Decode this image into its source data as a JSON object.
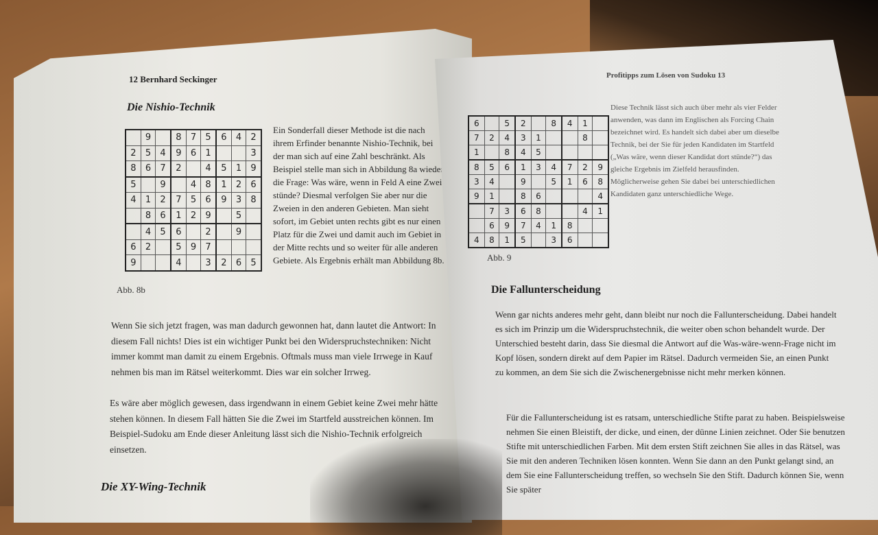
{
  "left_page": {
    "header": "12 Bernhard Seckinger",
    "section_title": "Die Nishio-Technik",
    "figure_caption": "Abb. 8b",
    "grid": [
      [
        "",
        "9",
        "",
        "8",
        "7",
        "5",
        "6",
        "4",
        "2"
      ],
      [
        "2",
        "5",
        "4",
        "9",
        "6",
        "1",
        "",
        "",
        "3"
      ],
      [
        "8",
        "6",
        "7",
        "2",
        "",
        "4",
        "5",
        "1",
        "9"
      ],
      [
        "5",
        "",
        "9",
        "",
        "4",
        "8",
        "1",
        "2",
        "6"
      ],
      [
        "4",
        "1",
        "2",
        "7",
        "5",
        "6",
        "9",
        "3",
        "8"
      ],
      [
        "",
        "8",
        "6",
        "1",
        "2",
        "9",
        "",
        "5",
        ""
      ],
      [
        "",
        "4",
        "5",
        "6",
        "",
        "2",
        "",
        "9",
        ""
      ],
      [
        "6",
        "2",
        "",
        "5",
        "9",
        "7",
        "",
        "",
        ""
      ],
      [
        "9",
        "",
        "",
        "4",
        "",
        "3",
        "2",
        "6",
        "5"
      ]
    ],
    "side_text": "Ein Sonderfall dieser Methode ist die nach ihrem Erfinder benannte Nishio-Technik, bei der man sich auf eine Zahl beschränkt. Als Beispiel stelle man sich in Abbildung 8a wieder die Frage: Was wäre, wenn in Feld A eine Zwei stünde? Diesmal verfolgen Sie aber nur die Zweien in den anderen Gebieten. Man sieht sofort, im Gebiet unten rechts gibt es nur einen Platz für die Zwei und damit auch im Gebiet in der Mitte rechts und so weiter für alle anderen Gebiete. Als Ergebnis erhält man Abbildung 8b.",
    "para_1": "Wenn Sie sich jetzt fragen, was man dadurch gewonnen hat, dann lautet die Antwort: In diesem Fall nichts! Dies ist ein wichtiger Punkt bei den Widerspruchstechniken: Nicht immer kommt man damit zu einem Ergebnis. Oftmals muss man viele Irrwege in Kauf nehmen bis man im Rätsel weiterkommt. Dies war ein solcher Irrweg.",
    "para_2": "Es wäre aber möglich gewesen, dass irgendwann in einem Gebiet keine Zwei mehr hätte stehen können. In diesem Fall hätten Sie die Zwei im Startfeld ausstreichen können. Im Beispiel-Sudoku am Ende dieser Anleitung lässt sich die Nishio-Technik erfolgreich einsetzen.",
    "next_section_title": "Die XY-Wing-Technik"
  },
  "right_page": {
    "header": "Profitipps zum Lösen von Sudoku 13",
    "figure_caption": "Abb. 9",
    "grid": [
      [
        "6",
        "",
        "5",
        "2",
        "",
        "8",
        "4",
        "1",
        ""
      ],
      [
        "7",
        "2",
        "4",
        "3",
        "1",
        "",
        "",
        "8",
        ""
      ],
      [
        "1",
        "",
        "8",
        "4",
        "5",
        "",
        "",
        "",
        ""
      ],
      [
        "8",
        "5",
        "6",
        "1",
        "3",
        "4",
        "7",
        "2",
        "9"
      ],
      [
        "3",
        "4",
        "",
        "9",
        "",
        "5",
        "1",
        "6",
        "8"
      ],
      [
        "9",
        "1",
        "",
        "8",
        "6",
        "",
        "",
        "",
        "4"
      ],
      [
        "",
        "7",
        "3",
        "6",
        "8",
        "",
        "",
        "4",
        "1"
      ],
      [
        "",
        "6",
        "9",
        "7",
        "4",
        "1",
        "8",
        "",
        ""
      ],
      [
        "4",
        "8",
        "1",
        "5",
        "",
        "3",
        "6",
        "",
        ""
      ]
    ],
    "side_text": "Diese Technik lässt sich auch über mehr als vier Felder anwenden, was dann im Englischen als Forcing Chain bezeichnet wird. Es handelt sich dabei aber um dieselbe Technik, bei der Sie für jeden Kandidaten im Startfeld („Was wäre, wenn dieser Kandidat dort stünde?“) das gleiche Ergebnis im Zielfeld herausfinden. Möglicherweise gehen Sie dabei bei unterschiedlichen Kandidaten ganz unterschiedliche Wege.",
    "section_title": "Die Fallunterscheidung",
    "para_1": "Wenn gar nichts anderes mehr geht, dann bleibt nur noch die Fallunterscheidung. Dabei handelt es sich im Prinzip um die Widerspruchstechnik, die weiter oben schon behandelt wurde. Der Unterschied besteht darin, dass Sie diesmal die Antwort auf die Was-wäre-wenn-Frage nicht im Kopf lösen, sondern direkt auf dem Papier im Rätsel. Dadurch vermeiden Sie, an einen Punkt zu kommen, an dem Sie sich die Zwischenergebnisse nicht mehr merken können.",
    "para_2": "Für die Fallunterscheidung ist es ratsam, unterschiedliche Stifte parat zu haben. Beispielsweise nehmen Sie einen Bleistift, der dicke, und einen, der dünne Linien zeichnet. Oder Sie benutzen Stifte mit unterschiedlichen Farben. Mit dem ersten Stift zeichnen Sie alles in das Rätsel, was Sie mit den anderen Techniken lösen konnten. Wenn Sie dann an den Punkt gelangt sind, an dem Sie eine Fallunterscheidung treffen, so wechseln Sie den Stift. Dadurch können Sie, wenn Sie später"
  },
  "colors": {
    "paper": "#ebeae5",
    "ink": "#2a2a2a",
    "table": "#b07a4a",
    "wall": "#0c0806"
  }
}
